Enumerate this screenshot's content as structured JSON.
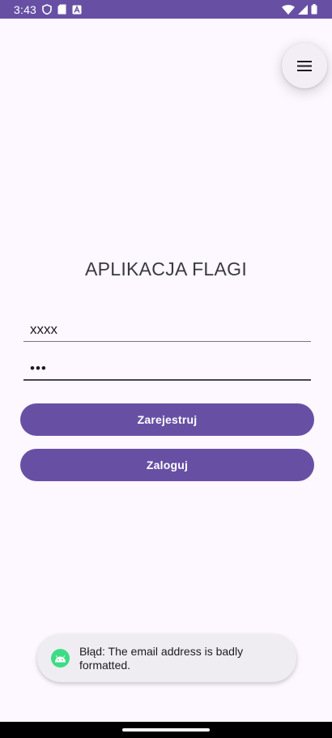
{
  "status_bar": {
    "time": "3:43",
    "background_color": "#6750a4",
    "left_icons": [
      "shield-icon",
      "sd-card-icon",
      "app-notification-icon"
    ],
    "right_icons": [
      "wifi-icon",
      "cell-signal-icon",
      "battery-icon"
    ]
  },
  "menu": {
    "icon": "hamburger-menu-icon"
  },
  "title": "APLIKACJA FLAGI",
  "form": {
    "email_value": "xxxx",
    "password_mask": "•••"
  },
  "buttons": {
    "register_label": "Zarejestruj",
    "login_label": "Zaloguj",
    "color": "#6750a4"
  },
  "toast": {
    "icon": "android-icon",
    "message": "Błąd: The email address is badly formatted."
  }
}
